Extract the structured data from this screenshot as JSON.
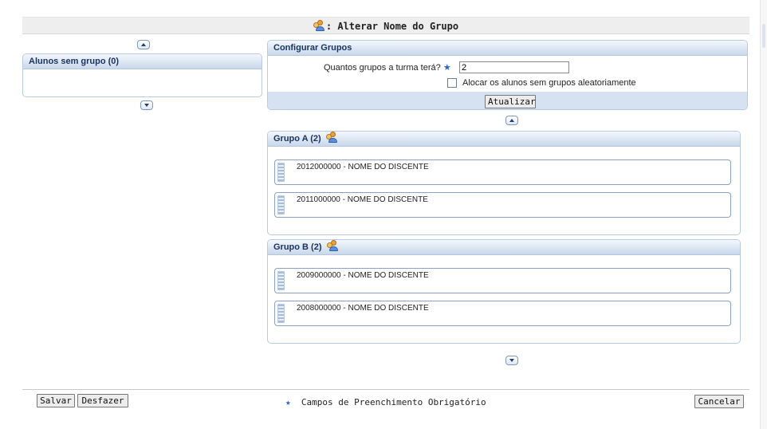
{
  "header": {
    "title": ": Alterar Nome do Grupo",
    "icon": "group-icon"
  },
  "sidebar": {
    "panel_title": "Alunos sem grupo (0)"
  },
  "config": {
    "title": "Configurar Grupos",
    "groups_label": "Quantos grupos a turma terá?",
    "required_mark": "★",
    "groups_value": "2",
    "random_label": "Alocar os alunos sem grupos aleatoriamente",
    "random_checked": false,
    "update_button": "Atualizar"
  },
  "groups": [
    {
      "title": "Grupo A (2)",
      "students": [
        "2012000000 -  NOME DO DISCENTE",
        "2011000000 -  NOME DO DISCENTE"
      ]
    },
    {
      "title": "Grupo B (2)",
      "students": [
        "2009000000 - NOME DO DISCENTE",
        "2008000000 - NOME DO DISCENTE"
      ]
    }
  ],
  "footer": {
    "save_button": "Salvar",
    "undo_button": "Desfazer",
    "required_note": "Campos de Preenchimento Obrigatório",
    "required_mark": "★",
    "cancel_button": "Cancelar"
  },
  "colors": {
    "accent": "#2d63c8",
    "panel_border": "#b9cbe3",
    "header_text": "#17335f"
  }
}
